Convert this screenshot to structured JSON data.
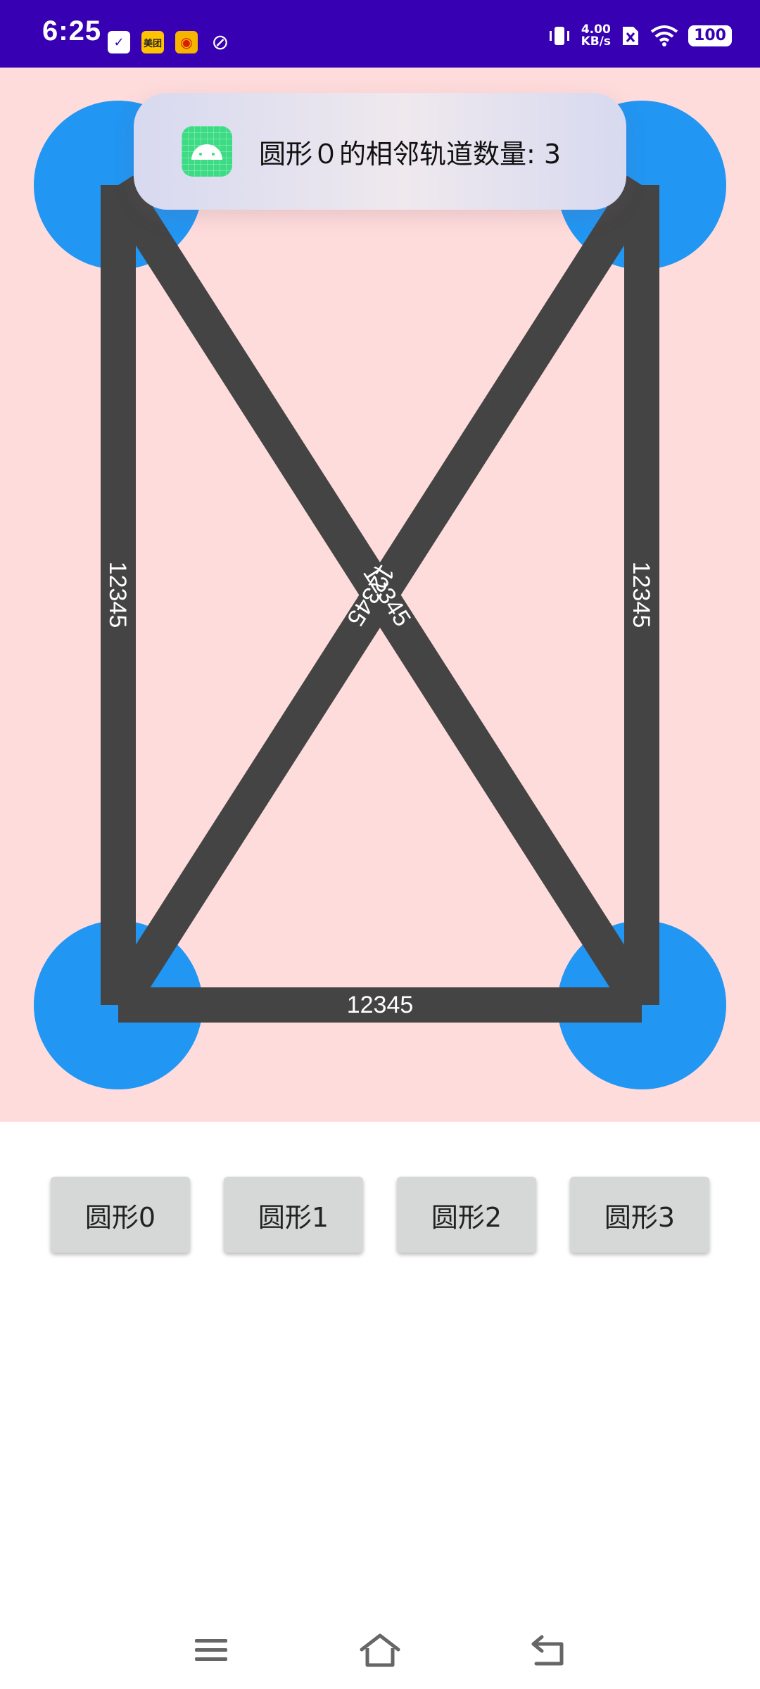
{
  "status_bar": {
    "time": "6:25",
    "net_speed_value": "4.00",
    "net_speed_unit": "KB/s",
    "battery": "100",
    "meituan_label": "美团"
  },
  "toast": {
    "message": "圆形０的相邻轨道数量: 3"
  },
  "graph": {
    "track_label_top_left_to_bottom_left": "12345",
    "track_label_top_right_to_bottom_right": "12345",
    "track_label_bottom": "12345",
    "track_label_diag_a": "12345",
    "track_label_diag_b": "12345"
  },
  "buttons": [
    {
      "label": "圆形0"
    },
    {
      "label": "圆形1"
    },
    {
      "label": "圆形2"
    },
    {
      "label": "圆形3"
    }
  ],
  "colors": {
    "status_bar": "#3700b3",
    "canvas_bg": "#ffdcdc",
    "circle": "#2196f3",
    "track": "#444444",
    "button_bg": "#d6d7d7"
  }
}
